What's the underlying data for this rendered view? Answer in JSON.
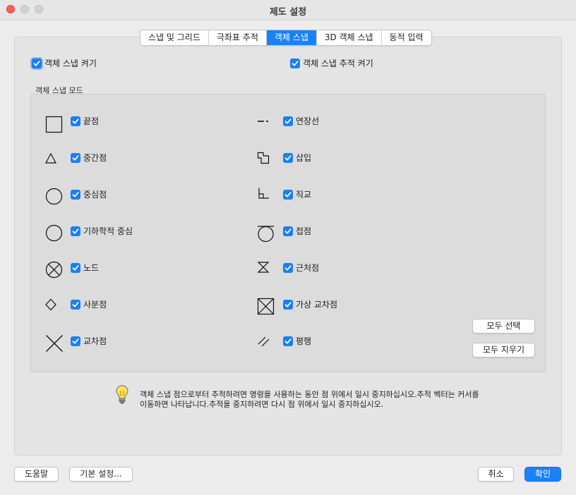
{
  "window": {
    "title": "제도 설정"
  },
  "tabs": [
    {
      "label": "스냅 및 그리드",
      "active": false
    },
    {
      "label": "극좌표 추적",
      "active": false
    },
    {
      "label": "객체 스냅",
      "active": true
    },
    {
      "label": "3D 객체 스냅",
      "active": false
    },
    {
      "label": "동적 입력",
      "active": false
    }
  ],
  "toggles": {
    "osnap_on": {
      "label": "객체 스냅 켜기",
      "checked": true
    },
    "osnap_track_on": {
      "label": "객체 스냅 추적 켜기",
      "checked": true
    }
  },
  "modes": {
    "title": "객체 스냅 모드",
    "left": [
      {
        "label": "끝점",
        "icon": "endpoint-icon",
        "checked": true
      },
      {
        "label": "중간점",
        "icon": "midpoint-icon",
        "checked": true
      },
      {
        "label": "중심점",
        "icon": "center-icon",
        "checked": true
      },
      {
        "label": "기하학적 중심",
        "icon": "geometric-center-icon",
        "checked": true
      },
      {
        "label": "노드",
        "icon": "node-icon",
        "checked": true
      },
      {
        "label": "사분점",
        "icon": "quadrant-icon",
        "checked": true
      },
      {
        "label": "교차점",
        "icon": "intersection-icon",
        "checked": true
      }
    ],
    "right": [
      {
        "label": "연장선",
        "icon": "extension-icon",
        "checked": true
      },
      {
        "label": "삽입",
        "icon": "insertion-icon",
        "checked": true
      },
      {
        "label": "직교",
        "icon": "perpendicular-icon",
        "checked": true
      },
      {
        "label": "접점",
        "icon": "tangent-icon",
        "checked": true
      },
      {
        "label": "근처점",
        "icon": "nearest-icon",
        "checked": true
      },
      {
        "label": "가상 교차점",
        "icon": "apparent-intersection-icon",
        "checked": true
      },
      {
        "label": "평행",
        "icon": "parallel-icon",
        "checked": true
      }
    ],
    "select_all": "모두 선택",
    "clear_all": "모두 지우기"
  },
  "hint": {
    "icon": "lightbulb-icon",
    "line1": "객체 스냅 점으로부터 추적하려면 명령을 사용하는 동안 점 위에서 일시 중지하십시오.추적 벡터는 커서를",
    "line2": "이동하면 나타납니다.추적을 중지하려면 다시 점 위에서 일시 중지하십시오."
  },
  "footer": {
    "help": "도움말",
    "defaults": "기본 설정...",
    "cancel": "취소",
    "ok": "확인"
  },
  "colors": {
    "accent": "#1a82f7"
  }
}
